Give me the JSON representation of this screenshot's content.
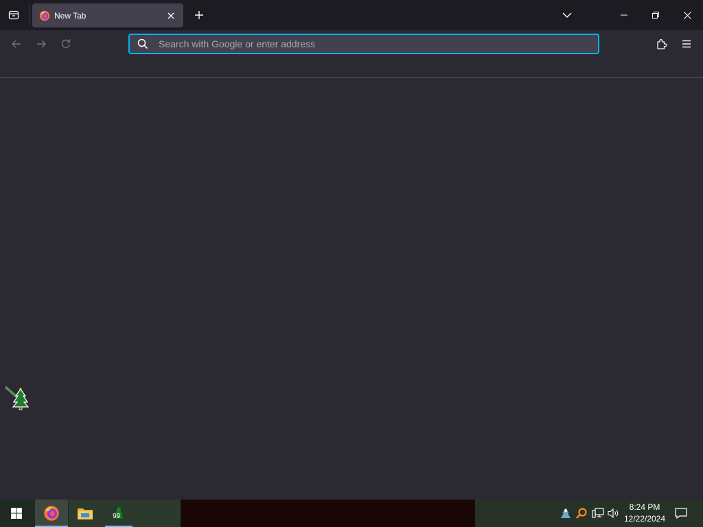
{
  "browser": {
    "tabs": [
      {
        "title": "New Tab",
        "active": true
      }
    ],
    "urlbar": {
      "placeholder": "Search with Google or enter address",
      "value": ""
    }
  },
  "taskbar": {
    "apps": [
      "firefox-icon",
      "file-explorer-icon",
      "christmas-tree-icon"
    ],
    "tree_badge": "99",
    "clock": {
      "time": "8:24 PM",
      "date": "12/22/2024"
    }
  },
  "colors": {
    "accent_focus": "#00b3f4",
    "tabstrip_bg": "#1c1b22",
    "toolbar_bg": "#2b2a33",
    "active_tab_bg": "#42414d"
  }
}
